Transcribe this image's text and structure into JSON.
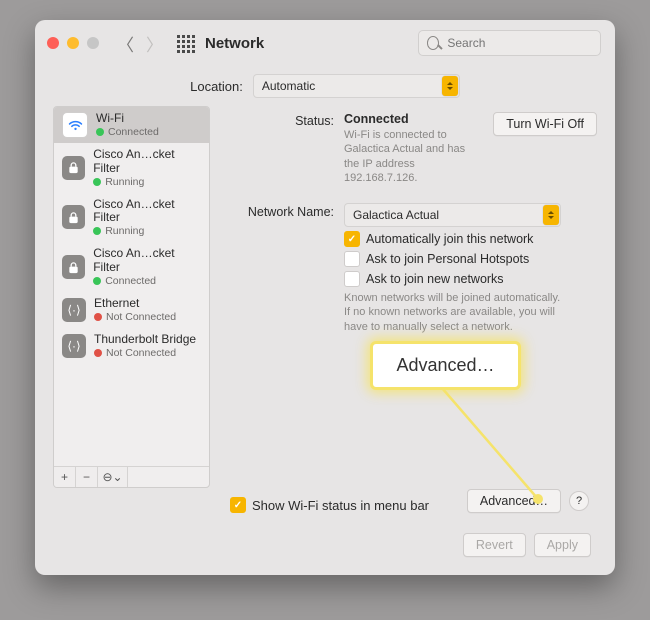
{
  "window": {
    "title": "Network"
  },
  "search": {
    "placeholder": "Search"
  },
  "location": {
    "label": "Location:",
    "value": "Automatic"
  },
  "services": [
    {
      "name": "Wi-Fi",
      "status": "Connected",
      "dot": "green",
      "icon": "wifi",
      "selected": true
    },
    {
      "name": "Cisco An…cket Filter",
      "status": "Running",
      "dot": "green",
      "icon": "lock"
    },
    {
      "name": "Cisco An…cket Filter",
      "status": "Running",
      "dot": "green",
      "icon": "lock"
    },
    {
      "name": "Cisco An…cket Filter",
      "status": "Connected",
      "dot": "green",
      "icon": "lock"
    },
    {
      "name": "Ethernet",
      "status": "Not Connected",
      "dot": "red",
      "icon": "ethernet"
    },
    {
      "name": "Thunderbolt Bridge",
      "status": "Not Connected",
      "dot": "red",
      "icon": "ethernet"
    }
  ],
  "sidebar_footer": {
    "add": "+",
    "remove": "−",
    "more": "⊖⌄"
  },
  "status": {
    "label": "Status:",
    "value": "Connected",
    "note": "Wi-Fi is connected to Galactica Actual and has the IP address 192.168.7.126.",
    "toggle": "Turn Wi-Fi Off"
  },
  "network_name": {
    "label": "Network Name:",
    "value": "Galactica Actual"
  },
  "checks": {
    "auto_join": "Automatically join this network",
    "ask_hotspot": "Ask to join Personal Hotspots",
    "ask_new": "Ask to join new networks",
    "known_note": "Known networks will be joined automatically. If no known networks are available, you will have to manually select a network."
  },
  "callout": {
    "text": "Advanced…"
  },
  "menubar": {
    "label": "Show Wi-Fi status in menu bar"
  },
  "advanced": "Advanced…",
  "help": "?",
  "buttons": {
    "revert": "Revert",
    "apply": "Apply"
  }
}
